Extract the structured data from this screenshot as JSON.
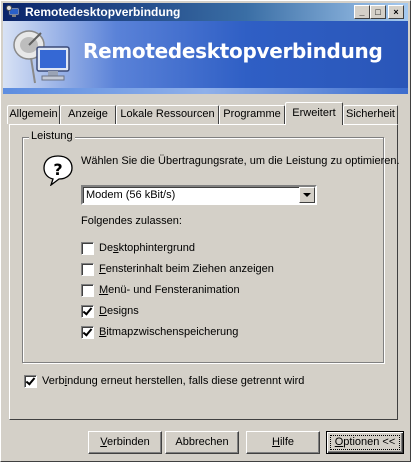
{
  "window": {
    "title": "Remotedesktopverbindung",
    "controls": {
      "minimize": "_",
      "maximize": "□",
      "close": "×"
    }
  },
  "banner": {
    "title": "Remotedesktopverbindung",
    "icon": "computer-satellite-icon"
  },
  "tabs": [
    {
      "label": "Allgemein",
      "active": false
    },
    {
      "label": "Anzeige",
      "active": false
    },
    {
      "label": "Lokale Ressourcen",
      "active": false
    },
    {
      "label": "Programme",
      "active": false
    },
    {
      "label": "Erweitert",
      "active": true
    },
    {
      "label": "Sicherheit",
      "active": false
    }
  ],
  "performance": {
    "group_label": "Leistung",
    "description": "Wählen Sie die Übertragungsrate, um die Leistung zu optimieren.",
    "connection_speed": "Modem (56 kBit/s)",
    "allow_label": "Folgendes zulassen:",
    "options": [
      {
        "pre": "De",
        "key": "s",
        "post": "ktophintergrund",
        "checked": false
      },
      {
        "pre": "",
        "key": "F",
        "post": "ensterinhalt beim Ziehen anzeigen",
        "checked": false
      },
      {
        "pre": "",
        "key": "M",
        "post": "enü- und Fensteranimation",
        "checked": false
      },
      {
        "pre": "",
        "key": "D",
        "post": "esigns",
        "checked": true
      },
      {
        "pre": "",
        "key": "B",
        "post": "itmapzwischenspeicherung",
        "checked": true
      }
    ]
  },
  "reconnect": {
    "pre": "Verb",
    "key": "i",
    "post": "ndung erneut herstellen, falls diese getrennt wird",
    "checked": true
  },
  "buttons": {
    "connect": {
      "key": "V",
      "post": "erbinden"
    },
    "cancel": "Abbrechen",
    "help": {
      "key": "H",
      "post": "ilfe"
    },
    "options": {
      "key": "O",
      "post": "ptionen <<"
    }
  }
}
